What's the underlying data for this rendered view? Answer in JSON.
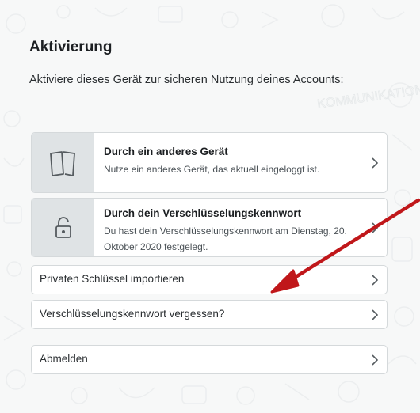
{
  "activation": {
    "title": "Aktivierung",
    "intro": "Aktiviere dieses Gerät zur sicheren Nutzung deines Accounts:"
  },
  "options": [
    {
      "title": "Durch ein anderes Gerät",
      "description": "Nutze ein anderes Gerät, das aktuell eingeloggt ist.",
      "icon": "devices-icon"
    },
    {
      "title": "Durch dein Verschlüsselungskennwort",
      "description": "Du hast dein Verschlüsselungskennwort am Dienstag, 20. Oktober 2020 festgelegt.",
      "icon": "lock-icon"
    }
  ],
  "links": {
    "import_key": "Privaten Schlüssel importieren",
    "forgot_password": "Verschlüsselungskennwort vergessen?",
    "logout": "Abmelden"
  },
  "background_words": [
    "KOMMUNIKATION"
  ],
  "colors": {
    "background": "#f7f8f8",
    "card_border": "#d5d9db",
    "icon_box": "#dfe3e5",
    "arrow": "#c0171a"
  }
}
